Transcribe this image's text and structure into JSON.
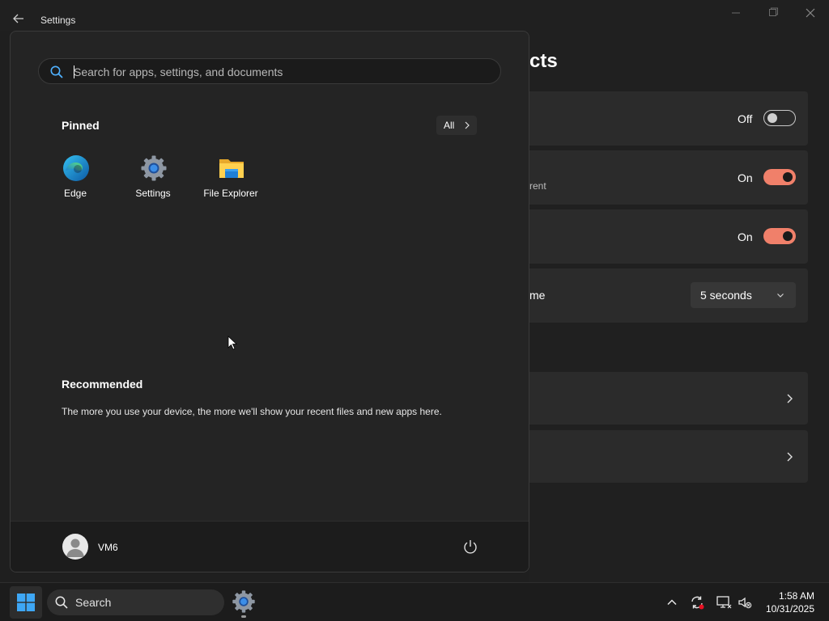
{
  "window": {
    "title": "Settings",
    "page_heading_fragment": "cts"
  },
  "settings_rows": [
    {
      "state": "Off",
      "subtitle": "",
      "label": ""
    },
    {
      "state": "On",
      "subtitle": "rent",
      "label": ""
    },
    {
      "state": "On",
      "subtitle": "",
      "label": ""
    },
    {
      "label": "me",
      "dropdown_value": "5 seconds"
    }
  ],
  "start_menu": {
    "search": {
      "placeholder": "Search for apps, settings, and documents"
    },
    "pinned": {
      "title": "Pinned",
      "all_label": "All",
      "apps": [
        {
          "name": "Edge",
          "icon": "edge-icon"
        },
        {
          "name": "Settings",
          "icon": "settings-gear-icon"
        },
        {
          "name": "File Explorer",
          "icon": "file-explorer-icon"
        }
      ]
    },
    "recommended": {
      "title": "Recommended",
      "message": "The more you use your device, the more we'll show your recent files and new apps here."
    },
    "user": {
      "name": "VM6"
    }
  },
  "taskbar": {
    "search_label": "Search",
    "time": "1:58 AM",
    "date": "10/31/2025"
  },
  "colors": {
    "accent": "#f0806a",
    "background": "#202020",
    "card": "#2b2b2b"
  }
}
